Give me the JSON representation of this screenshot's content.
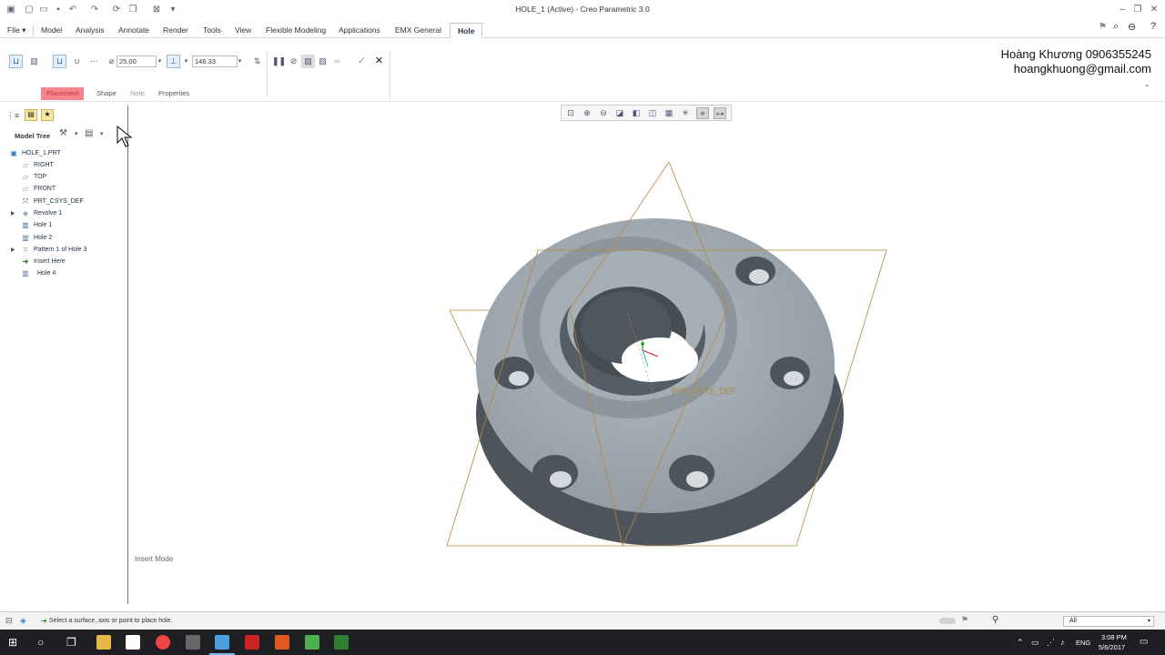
{
  "window": {
    "title": "HOLE_1 (Active) - Creo Parametric 3.0"
  },
  "menu": {
    "tabs": [
      "File",
      "Model",
      "Analysis",
      "Annotate",
      "Render",
      "Tools",
      "View",
      "Flexible Modeling",
      "Applications",
      "EMX General",
      "Hole"
    ],
    "active": "Hole"
  },
  "ribbon": {
    "diameter_value": "25.00",
    "depth_value": "146.33",
    "subtabs": [
      "Placement",
      "Shape",
      "Note",
      "Properties"
    ]
  },
  "watermark": {
    "line1": "Hoàng Khương 0906355245",
    "line2": "hoangkhuong@gmail.com"
  },
  "tree": {
    "header": "Model Tree",
    "items": [
      {
        "label": "HOLE_1.PRT",
        "icon": "part-icon"
      },
      {
        "label": "RIGHT",
        "icon": "datum-plane-icon"
      },
      {
        "label": "TOP",
        "icon": "datum-plane-icon"
      },
      {
        "label": "FRONT",
        "icon": "datum-plane-icon"
      },
      {
        "label": "PRT_CSYS_DEF",
        "icon": "csys-icon"
      },
      {
        "label": "Revolve 1",
        "icon": "revolve-icon"
      },
      {
        "label": "Hole 1",
        "icon": "hole-icon"
      },
      {
        "label": "Hole 2",
        "icon": "hole-icon"
      },
      {
        "label": "Pattern 1 of Hole 3",
        "icon": "pattern-icon"
      },
      {
        "label": "Insert Here",
        "icon": "insert-arrow-icon"
      },
      {
        "label": "Hole 4",
        "icon": "hole-icon"
      }
    ]
  },
  "viewport": {
    "mode_label": "Insert Mode",
    "csys_label": "PRT_CSYS_DEF"
  },
  "status": {
    "message": "Select a surface, axis or point to place hole.",
    "filter_value": "All"
  },
  "taskbar": {
    "language": "ENG",
    "time": "3:08 PM",
    "date": "5/6/2017"
  },
  "colors": {
    "placement_tab": "#f4858e",
    "part_surface": "#9aa3ab",
    "part_shadow": "#4d545b",
    "datum_plane": "#b08a3c"
  }
}
